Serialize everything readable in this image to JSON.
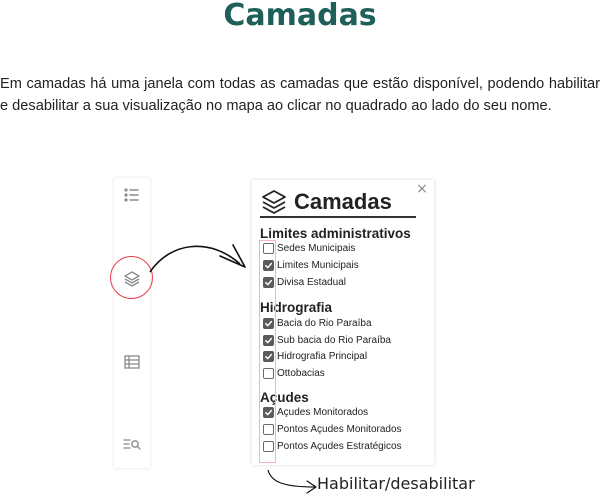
{
  "page": {
    "title": "Camadas",
    "intro": "Em camadas há uma janela com todas as camadas que estão disponível, podendo habilitar e desabilitar a sua visualização no mapa ao clicar no quadrado ao lado do seu nome."
  },
  "toolbar": {
    "icons": [
      "list-icon",
      "layers-icon",
      "table-icon",
      "search-list-icon"
    ],
    "highlighted": "layers-icon"
  },
  "panel": {
    "title": "Camadas",
    "close_label": "×",
    "groups": [
      {
        "title": "Limites administrativos",
        "layers": [
          {
            "label": "Sedes Municipais",
            "checked": false
          },
          {
            "label": "Limites Municipais",
            "checked": true
          },
          {
            "label": "Divisa Estadual",
            "checked": true
          }
        ]
      },
      {
        "title": "Hidrografia",
        "layers": [
          {
            "label": "Bacia do Rio Paraíba",
            "checked": true
          },
          {
            "label": "Sub bacia do Rio Paraíba",
            "checked": true
          },
          {
            "label": "Hidrografia Principal",
            "checked": true
          },
          {
            "label": "Ottobacias",
            "checked": false
          }
        ]
      },
      {
        "title": "Açudes",
        "layers": [
          {
            "label": "Açudes Monitorados",
            "checked": true
          },
          {
            "label": "Pontos Açudes Monitorados",
            "checked": false
          },
          {
            "label": "Pontos Açudes Estratégicos",
            "checked": false
          }
        ]
      }
    ]
  },
  "annotation": {
    "label": "Habilitar/desabilitar",
    "highlight_color": "#e53e48"
  },
  "colors": {
    "title": "#1e5f5a",
    "checkbox_checked": "#5b5b5b"
  }
}
